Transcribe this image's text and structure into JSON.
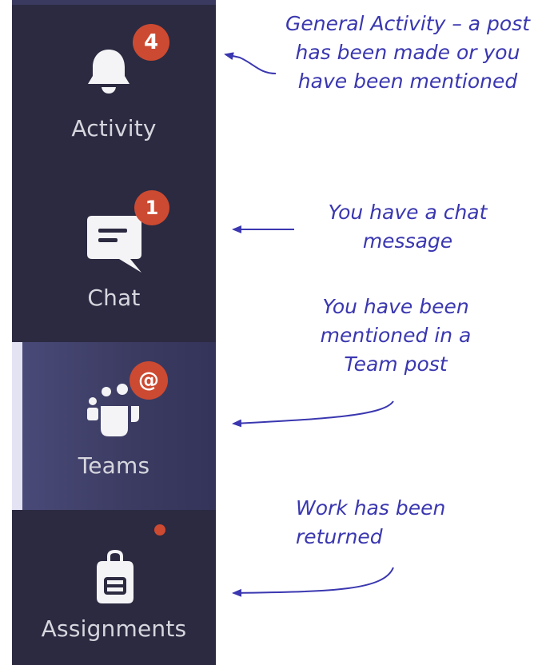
{
  "sidebar": {
    "items": [
      {
        "label": "Activity",
        "icon": "bell-icon",
        "badge": "4",
        "selected": false
      },
      {
        "label": "Chat",
        "icon": "chat-icon",
        "badge": "1",
        "selected": false
      },
      {
        "label": "Teams",
        "icon": "teams-icon",
        "badge": "@",
        "selected": true
      },
      {
        "label": "Assignments",
        "icon": "backpack-icon",
        "badge": "",
        "selected": false
      }
    ]
  },
  "annotations": {
    "activity": "General Activity – a post has been made or you have been mentioned",
    "chat": "You have a chat message",
    "teams": "You have been mentioned in a Team post",
    "assignments": "Work has been returned"
  },
  "colors": {
    "rail_background": "#2b2a41",
    "selected_background": "#3c3c63",
    "selected_indicator": "#e3e3f3",
    "badge": "#cc4a31",
    "label_text": "#d6d6de",
    "annotation_text": "#3a37b0"
  }
}
